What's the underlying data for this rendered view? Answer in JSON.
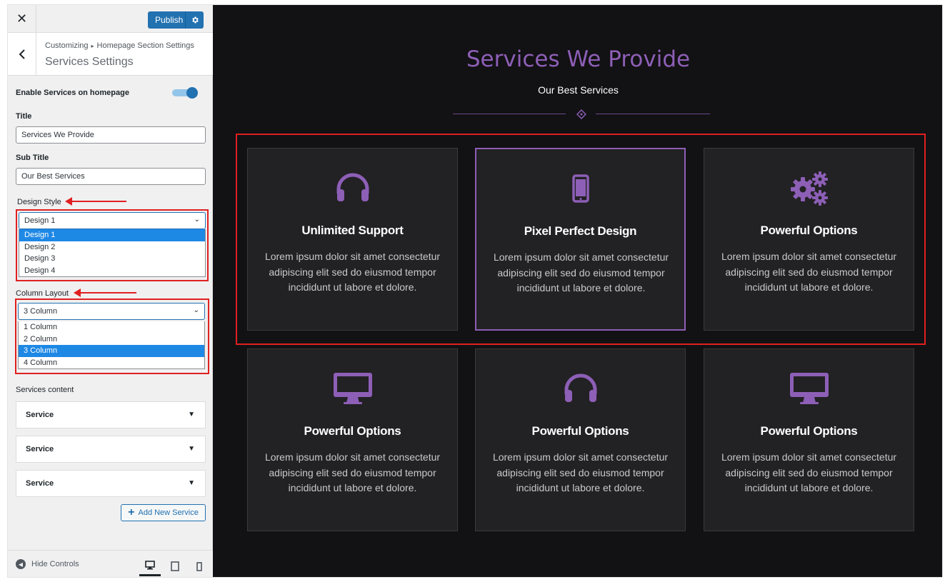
{
  "sidebar": {
    "publish_label": "Publish",
    "breadcrumb": [
      "Customizing",
      "Homepage Section Settings"
    ],
    "section_title": "Services Settings",
    "enable_label": "Enable Services on homepage",
    "enable_value": true,
    "title_label": "Title",
    "title_value": "Services We Provide",
    "subtitle_label": "Sub Title",
    "subtitle_value": "Our Best Services",
    "design_style": {
      "label": "Design Style",
      "selected": "Design 1",
      "options": [
        "Design 1",
        "Design 2",
        "Design 3",
        "Design 4"
      ]
    },
    "column_layout": {
      "label": "Column Layout",
      "selected": "3 Column",
      "options": [
        "1 Column",
        "2 Column",
        "3 Column",
        "4 Column"
      ]
    },
    "services_content_label": "Services content",
    "services": [
      "Service",
      "Service",
      "Service"
    ],
    "add_service_label": "Add New Service",
    "hide_controls_label": "Hide Controls"
  },
  "preview": {
    "title": "Services We Provide",
    "subtitle": "Our Best Services",
    "cards": [
      {
        "icon": "headphones-icon",
        "title": "Unlimited Support",
        "desc": "Lorem ipsum dolor sit amet consectetur adipiscing elit sed do eiusmod tempor incididunt ut labore et dolore."
      },
      {
        "icon": "mobile-icon",
        "title": "Pixel Perfect Design",
        "desc": "Lorem ipsum dolor sit amet consectetur adipiscing elit sed do eiusmod tempor incididunt ut labore et dolore."
      },
      {
        "icon": "gears-icon",
        "title": "Powerful Options",
        "desc": "Lorem ipsum dolor sit amet consectetur adipiscing elit sed do eiusmod tempor incididunt ut labore et dolore."
      },
      {
        "icon": "desktop-icon",
        "title": "Powerful Options",
        "desc": "Lorem ipsum dolor sit amet consectetur adipiscing elit sed do eiusmod tempor incididunt ut labore et dolore."
      },
      {
        "icon": "headphones-icon",
        "title": "Powerful Options",
        "desc": "Lorem ipsum dolor sit amet consectetur adipiscing elit sed do eiusmod tempor incididunt ut labore et dolore."
      },
      {
        "icon": "desktop-icon",
        "title": "Powerful Options",
        "desc": "Lorem ipsum dolor sit amet consectetur adipiscing elit sed do eiusmod tempor incididunt ut labore et dolore."
      }
    ]
  },
  "colors": {
    "accent": "#8d5fb6",
    "wp_blue": "#2271b1",
    "annotation_red": "#e02020",
    "preview_bg": "#121114",
    "card_bg": "#222124"
  }
}
